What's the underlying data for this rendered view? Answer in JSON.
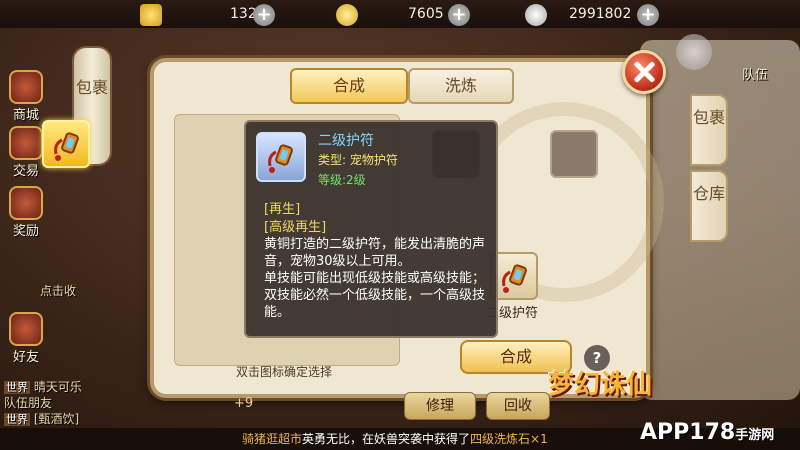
{
  "resources": [
    {
      "icon": "gold-ingot-icon",
      "value": "132"
    },
    {
      "icon": "gold-coin-icon",
      "value": "7605"
    },
    {
      "icon": "silver-coin-icon",
      "value": "2991802"
    }
  ],
  "sidebar": [
    {
      "label": "商城",
      "icon": "shop-icon"
    },
    {
      "label": "交易",
      "icon": "trade-icon"
    },
    {
      "label": "奖励",
      "icon": "reward-icon"
    },
    {
      "label": "好友",
      "icon": "friends-icon"
    }
  ],
  "left_widgets": {
    "collect": "点击收"
  },
  "lantern_label": "包裹",
  "right_tabs": {
    "bag": "包裹",
    "warehouse": "仓库",
    "team": "队伍"
  },
  "panel": {
    "tabs": [
      {
        "label": "合成",
        "active": true
      },
      {
        "label": "洗炼",
        "active": false
      }
    ],
    "hint": "双击图标确定选择",
    "compose_button": "合成",
    "help": "?",
    "result_label": "二级护符",
    "badge": "+9",
    "under_buttons": [
      "修理",
      "回收"
    ]
  },
  "tooltip": {
    "title": "二级护符",
    "type": "类型: 宠物护符",
    "level": "等级:2级",
    "skills": [
      "[再生]",
      "[高级再生]"
    ],
    "desc1": "黄铜打造的二级护符，能发出清脆的声音，宠物30级以上可用。",
    "desc2": "单技能可能出现低级技能或高级技能；双技能必然一个低级技能，一个高级技能。"
  },
  "chat": [
    {
      "tag": "世界",
      "text": "晴天可乐"
    },
    {
      "tag": "",
      "text": "队伍朋友"
    },
    {
      "tag": "世界",
      "text": "[甄酒饮]"
    }
  ],
  "bottom_message": {
    "player": "骑猪逛超市",
    "mid": "英勇无比，在妖兽突袭中获得了",
    "item": "四级洗炼石×1"
  },
  "watermarks": {
    "game": "梦幻诛仙",
    "site": "APP178",
    "site_sub": "手游网"
  },
  "colors": {
    "accent": "#f2c758",
    "tooltip_title": "#7fd6ff",
    "tooltip_type": "#f4e27a",
    "tooltip_level": "#74e26a",
    "highlight": "#f2b24a"
  }
}
